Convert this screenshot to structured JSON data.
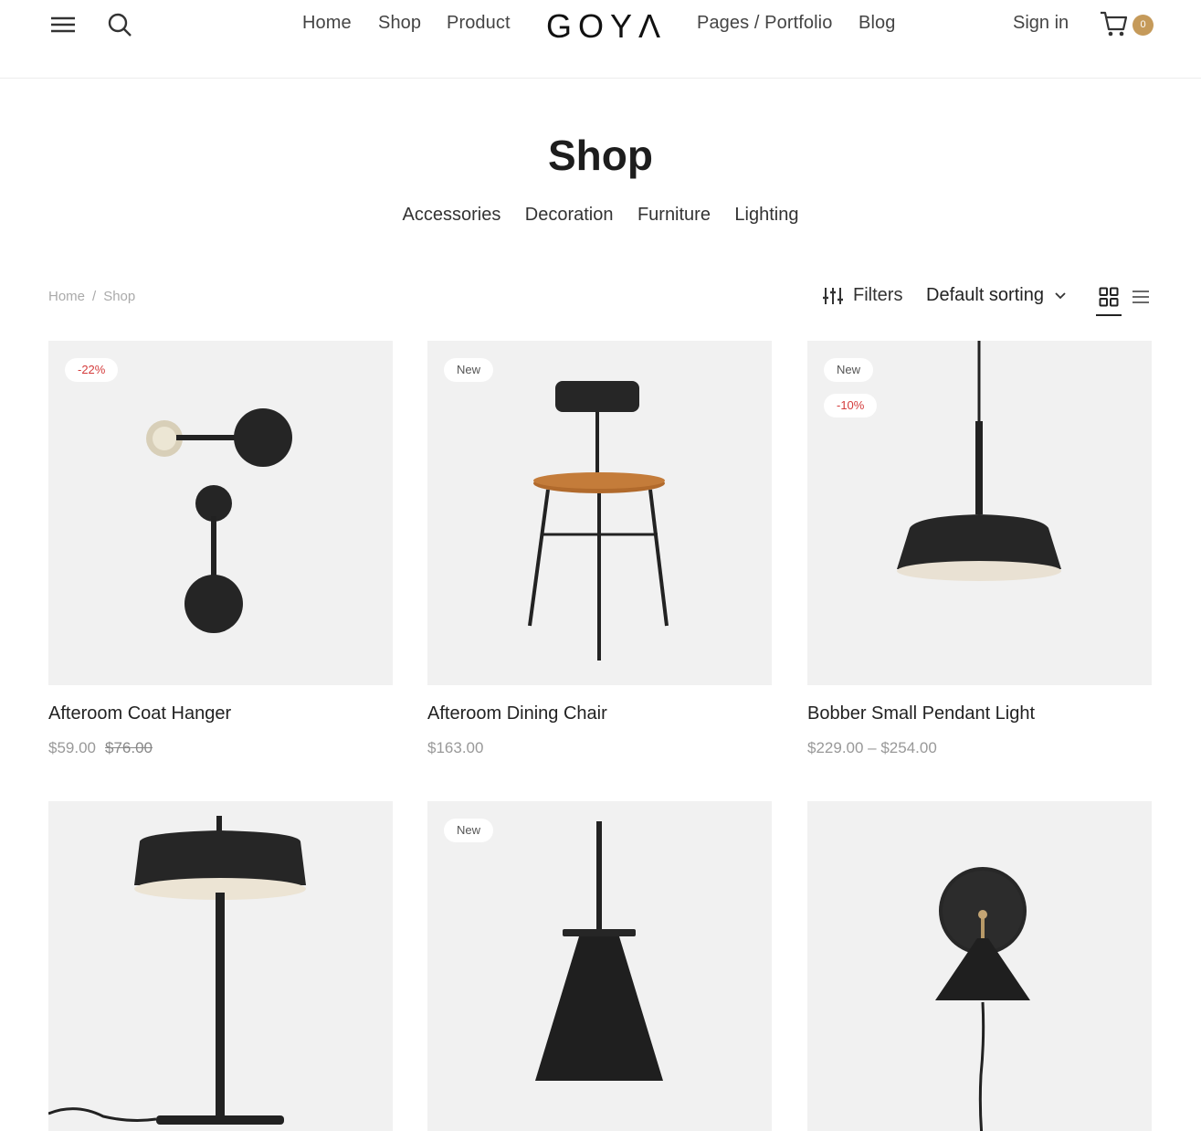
{
  "header": {
    "nav_left": [
      "Home",
      "Shop",
      "Product"
    ],
    "logo": "GOYΛ",
    "nav_right": [
      "Pages / Portfolio",
      "Blog"
    ],
    "sign_in": "Sign in",
    "cart_count": "0",
    "accent_color": "#c59a5a"
  },
  "page": {
    "title": "Shop",
    "categories": [
      "Accessories",
      "Decoration",
      "Furniture",
      "Lighting"
    ]
  },
  "toolbar": {
    "breadcrumb": [
      "Home",
      "Shop"
    ],
    "filters_label": "Filters",
    "sort_label": "Default sorting",
    "view_modes": [
      "grid-view-icon",
      "list-view-icon"
    ],
    "active_view": "grid"
  },
  "products": [
    {
      "name": "Afteroom Coat Hanger",
      "price": "$59.00",
      "old_price": "$76.00",
      "badges": [
        "-22%"
      ]
    },
    {
      "name": "Afteroom Dining Chair",
      "price": "$163.00",
      "old_price": "",
      "badges": [
        "New"
      ]
    },
    {
      "name": "Bobber Small Pendant Light",
      "price": "$229.00 – $254.00",
      "old_price": "",
      "badges": [
        "New",
        "-10%"
      ]
    },
    {
      "name": "",
      "price": "",
      "old_price": "",
      "badges": []
    },
    {
      "name": "",
      "price": "",
      "old_price": "",
      "badges": [
        "New"
      ]
    },
    {
      "name": "",
      "price": "",
      "old_price": "",
      "badges": []
    }
  ],
  "colors": {
    "sale_badge": "#d43c3c",
    "thumb_bg": "#f1f1f1"
  }
}
